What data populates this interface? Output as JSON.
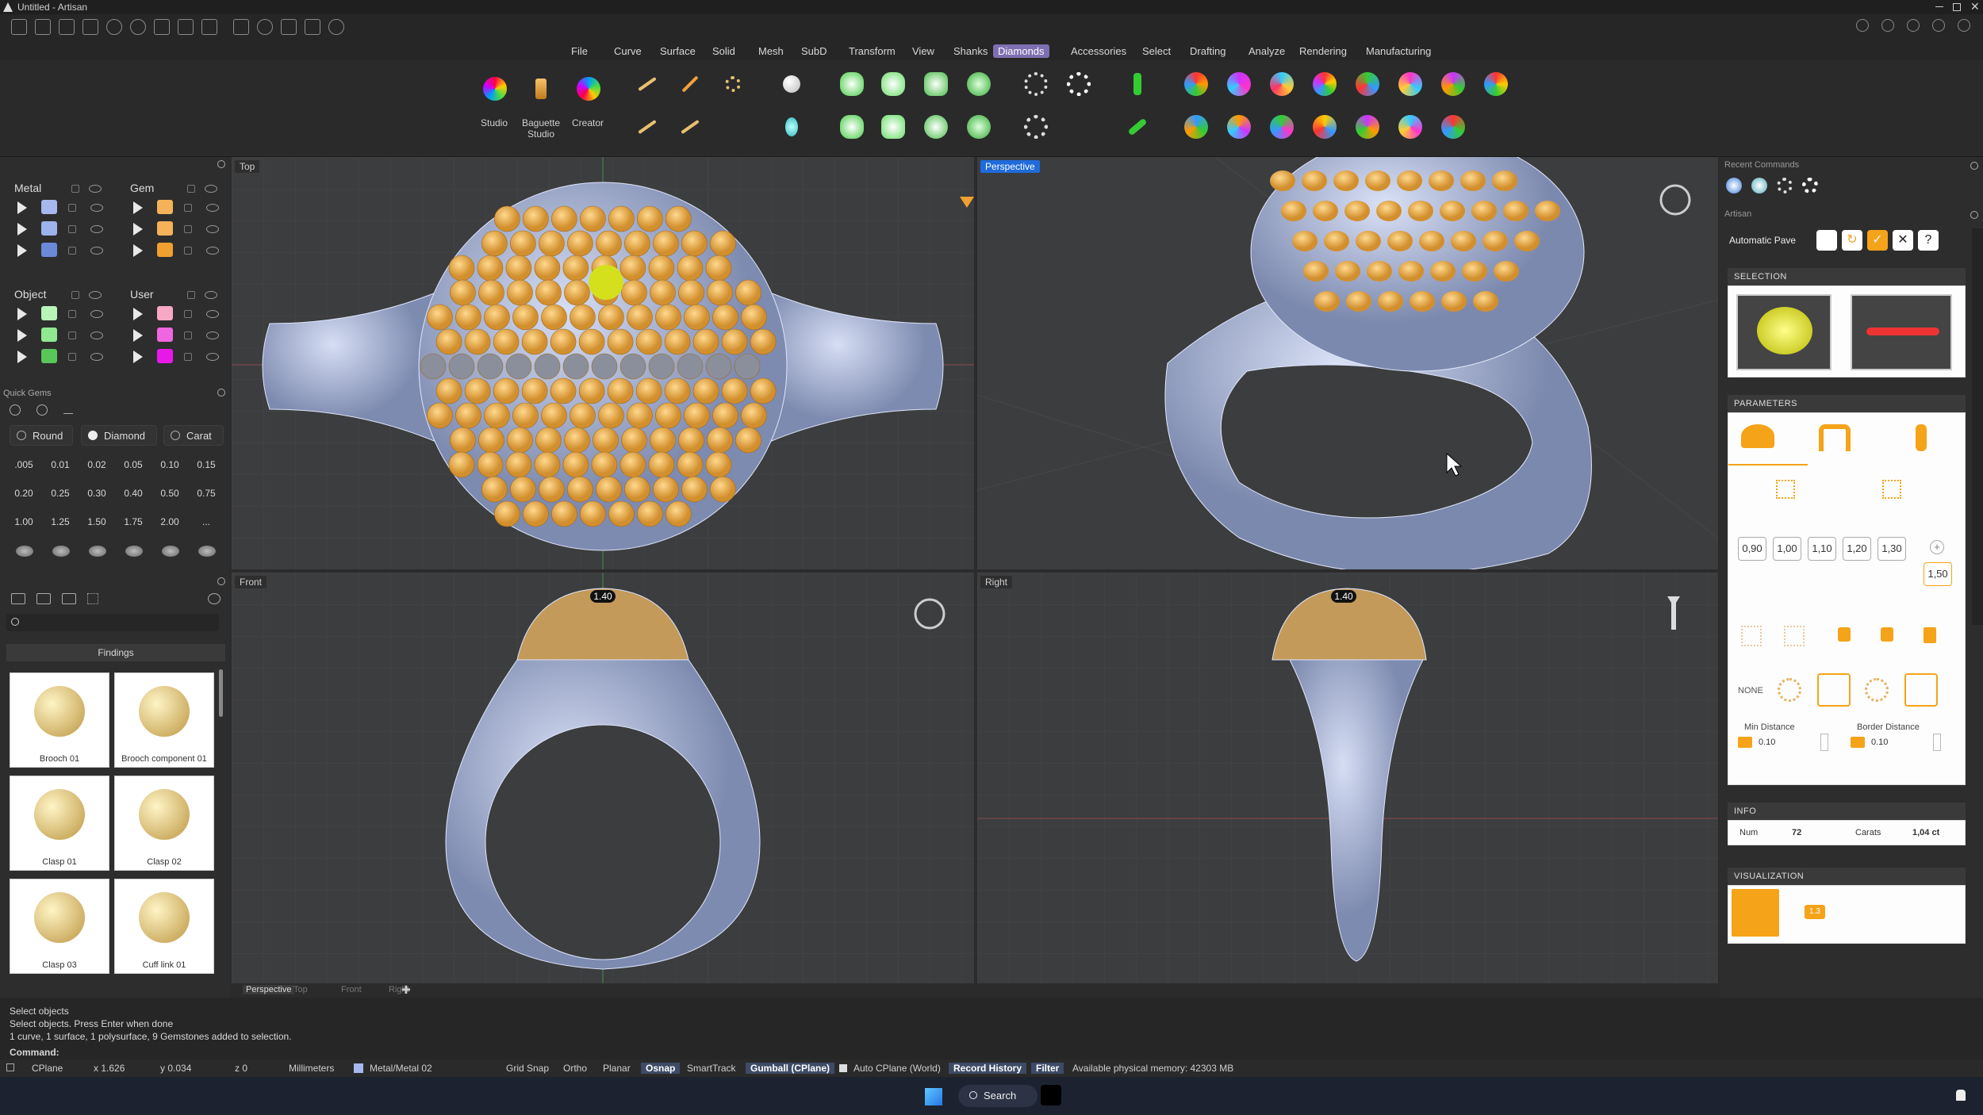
{
  "window": {
    "title": "Untitled - Artisan"
  },
  "menu": [
    "File",
    "Curve",
    "Surface",
    "Solid",
    "Mesh",
    "SubD",
    "Transform",
    "View",
    "Shanks",
    "Diamonds",
    "Accessories",
    "Select",
    "Drafting",
    "Analyze",
    "Rendering",
    "Manufacturing"
  ],
  "menu_active": "Diamonds",
  "ribbon": {
    "studio": "Studio",
    "baguette_studio": "Baguette Studio",
    "creator": "Creator"
  },
  "layers": {
    "metal": {
      "label": "Metal",
      "colors": [
        "#a7b8ef",
        "#9db3ee",
        "#6c89d8"
      ]
    },
    "gem": {
      "label": "Gem",
      "colors": [
        "#f5b25a",
        "#f5b25a",
        "#f0a030"
      ]
    },
    "object": {
      "label": "Object",
      "colors": [
        "#b9f5b9",
        "#90e890",
        "#59c659"
      ]
    },
    "user": {
      "label": "User",
      "colors": [
        "#f7a8c4",
        "#f066e0",
        "#e818e8"
      ]
    }
  },
  "quick_gems": {
    "title": "Quick Gems",
    "shape": "Round",
    "type": "Diamond",
    "unit": "Carat",
    "values": [
      ".005",
      "0.01",
      "0.02",
      "0.05",
      "0.10",
      "0.15",
      "0.20",
      "0.25",
      "0.30",
      "0.40",
      "0.50",
      "0.75",
      "1.00",
      "1.25",
      "1.50",
      "1.75",
      "2.00",
      "..."
    ]
  },
  "library": {
    "category": "Findings",
    "search_placeholder": "",
    "items": [
      "Brooch 01",
      "Brooch component 01",
      "Clasp 01",
      "Clasp 02",
      "Clasp 03",
      "Cuff link 01"
    ]
  },
  "viewports": {
    "top": "Top",
    "perspective": "Perspective",
    "front": "Front",
    "right": "Right",
    "front_badge": "1.40",
    "right_badge": "1.40"
  },
  "viewport_tabs": [
    "Perspective",
    "Top",
    "Front",
    "Right"
  ],
  "right_panel": {
    "recent_title": "Recent Commands",
    "artisan_title": "Artisan",
    "command_name": "Automatic Pave",
    "selection_title": "SELECTION",
    "parameters_title": "PARAMETERS",
    "sizes": [
      "0,90",
      "1,00",
      "1,10",
      "1,20",
      "1,30"
    ],
    "size_selected": "1,50",
    "none_label": "NONE",
    "min_distance_label": "Min Distance",
    "border_distance_label": "Border Distance",
    "min_distance": "0.10",
    "border_distance": "0.10",
    "info_title": "INFO",
    "num_label": "Num",
    "num_value": "72",
    "carats_label": "Carats",
    "carats_value": "1,04 ct",
    "visualization_title": "VISUALIZATION",
    "vis_badge": "1.3"
  },
  "command_history": [
    "Select objects",
    "Select objects. Press Enter when done",
    "1 curve, 1 surface, 1 polysurface, 9 Gemstones added to selection."
  ],
  "command_prompt": "Command:",
  "status": {
    "cplane": "CPlane",
    "x": "x 1.626",
    "y": "y 0.034",
    "z": "z 0",
    "units": "Millimeters",
    "layer": "Metal/Metal 02",
    "grid_snap": "Grid Snap",
    "ortho": "Ortho",
    "planar": "Planar",
    "osnap": "Osnap",
    "smarttrack": "SmartTrack",
    "gumball": "Gumball (CPlane)",
    "auto_cplane": "Auto CPlane (World)",
    "record_history": "Record History",
    "filter": "Filter",
    "memory": "Available physical memory: 42303 MB"
  },
  "taskbar": {
    "search": "Search"
  }
}
